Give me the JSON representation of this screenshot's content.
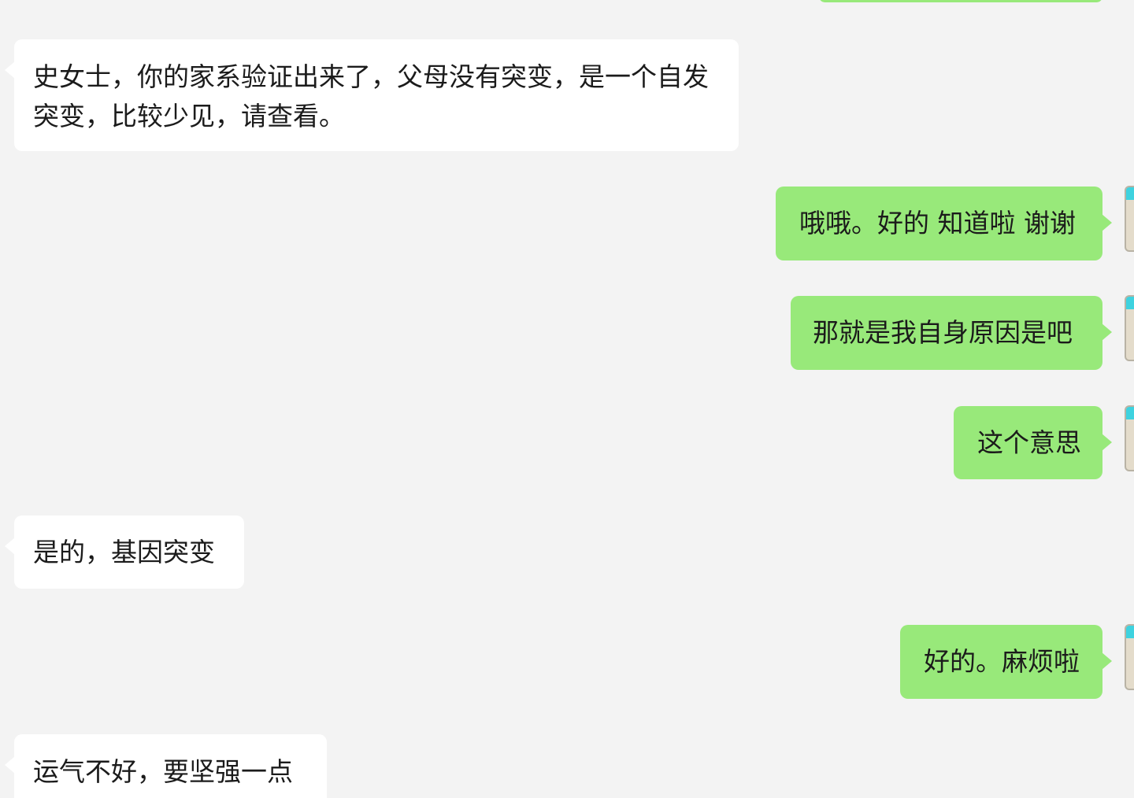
{
  "colors": {
    "background": "#f3f3f3",
    "incoming_bubble": "#ffffff",
    "outgoing_bubble": "#98e97a",
    "avatar_accent": "#3ed2df"
  },
  "messages": [
    {
      "sender": "other",
      "text": "史女士，你的家系验证出来了，父母没有突变，是一个自发突变，比较少见，请查看。"
    },
    {
      "sender": "me",
      "text": "哦哦。好的 知道啦 谢谢"
    },
    {
      "sender": "me",
      "text": "那就是我自身原因是吧"
    },
    {
      "sender": "me",
      "text": "这个意思"
    },
    {
      "sender": "other",
      "text": "是的，基因突变"
    },
    {
      "sender": "me",
      "text": "好的。麻烦啦"
    },
    {
      "sender": "other",
      "text": "运气不好，要坚强一点"
    }
  ]
}
